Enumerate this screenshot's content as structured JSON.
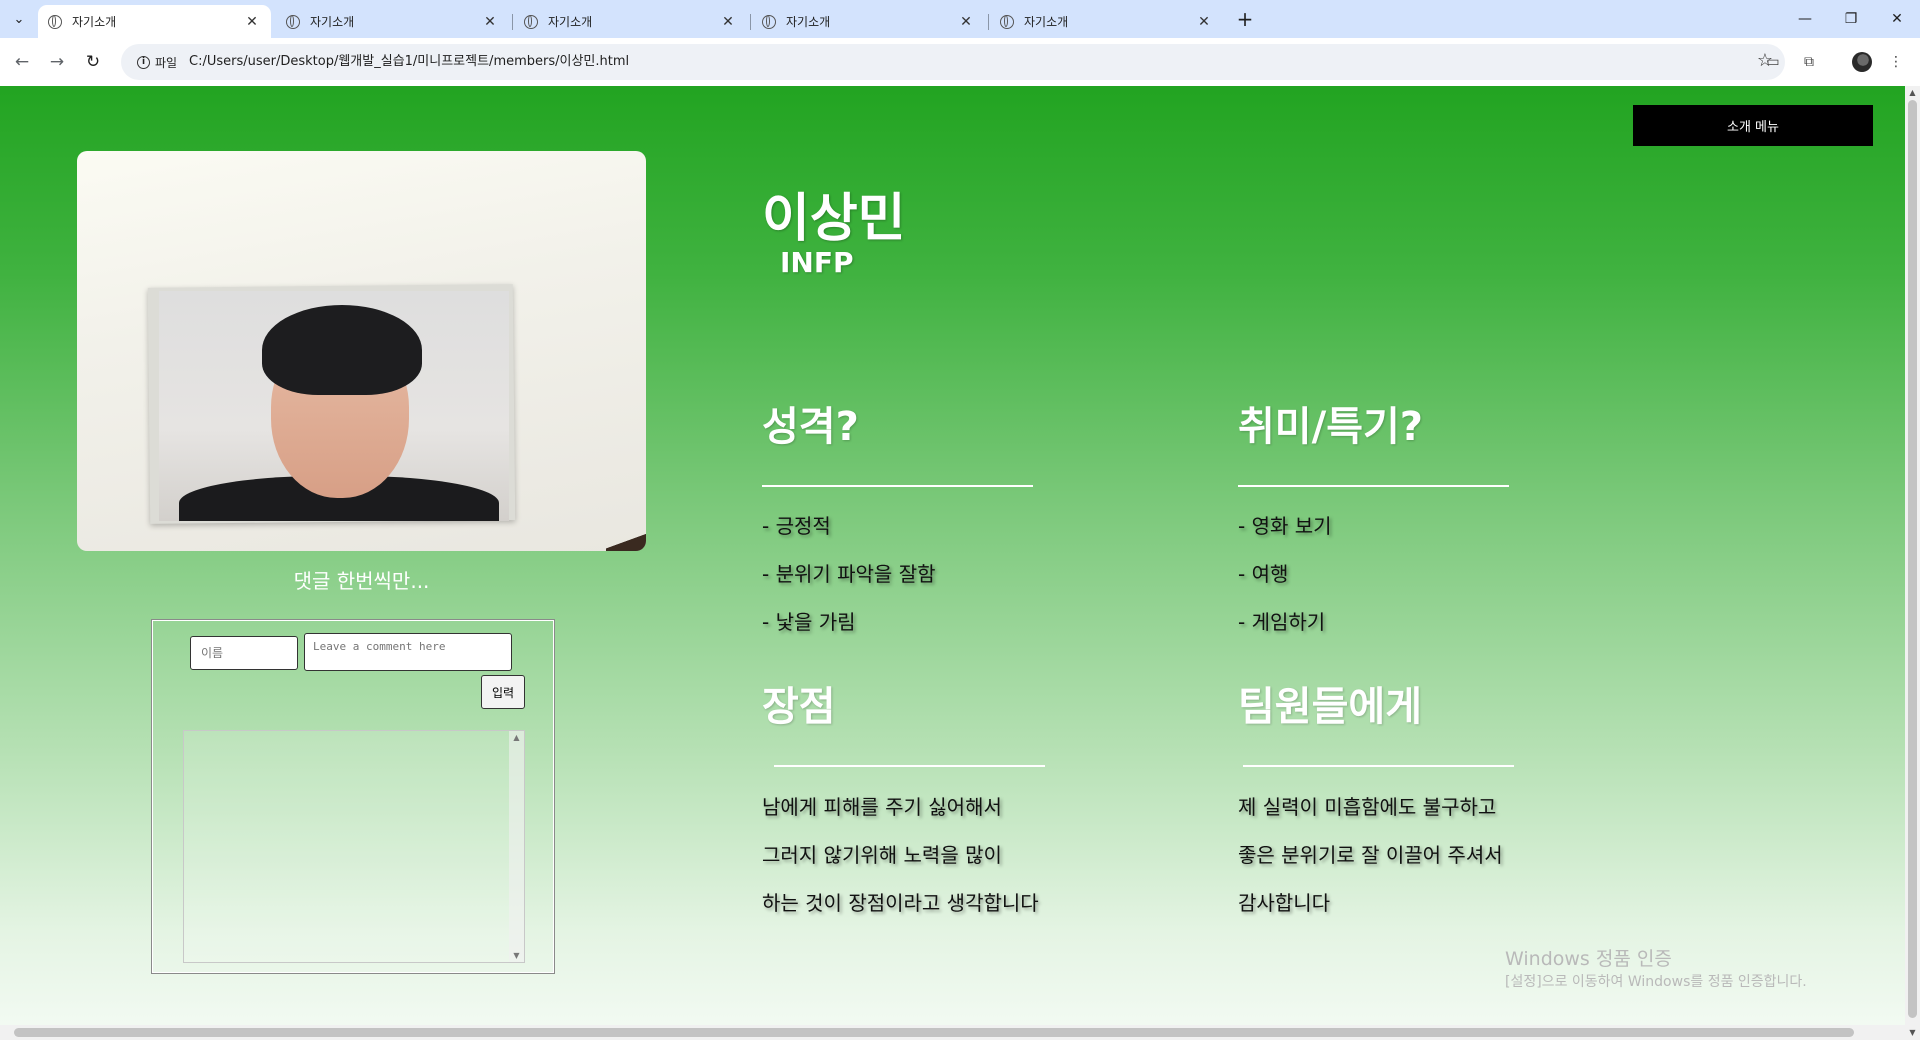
{
  "browser": {
    "tabs": [
      {
        "title": "자기소개",
        "active": true
      },
      {
        "title": "자기소개",
        "active": false
      },
      {
        "title": "자기소개",
        "active": false
      },
      {
        "title": "자기소개",
        "active": false
      },
      {
        "title": "자기소개",
        "active": false
      }
    ],
    "new_tab_icon": "plus-icon",
    "site_chip_label": "파일",
    "url": "C:/Users/user/Desktop/웹개발_실습1/미니프로젝트/members/이상민.html"
  },
  "page": {
    "menu_button_label": "소개 메뉴",
    "comment_title": "댓글 한번씩만...",
    "name_placeholder": "이름",
    "comment_placeholder": "Leave a comment here",
    "submit_label": "입력",
    "person_name": "이상민",
    "mbti": "INFP",
    "sections": {
      "personality": {
        "title": "성격?",
        "lines": [
          "- 긍정적",
          "- 분위기 파악을 잘함",
          "- 낯을 가림"
        ]
      },
      "hobbies": {
        "title": "취미/특기?",
        "lines": [
          "- 영화 보기",
          "- 여행",
          "- 게임하기"
        ]
      },
      "strengths": {
        "title": "장점",
        "lines": [
          "남에게 피해를 주기 싫어해서",
          "그러지 않기위해 노력을 많이",
          "하는 것이 장점이라고 생각합니다"
        ]
      },
      "to_team": {
        "title": "팀원들에게",
        "lines": [
          "제 실력이 미흡함에도 불구하고",
          "좋은 분위기로 잘 이끌어 주셔서",
          "감사합니다"
        ]
      }
    },
    "background_colors": {
      "top": "#22a421",
      "bottom": "#f2faf2"
    }
  },
  "os": {
    "watermark_title": "Windows 정품 인증",
    "watermark_sub": "[설정]으로 이동하여 Windows를 정품 인증합니다."
  }
}
